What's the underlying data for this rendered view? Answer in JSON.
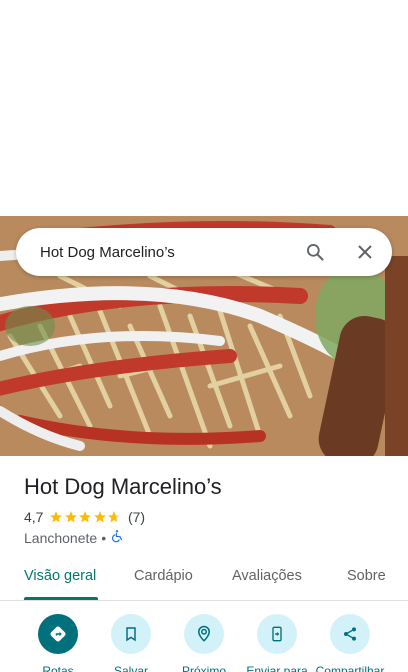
{
  "search": {
    "query": "Hot Dog Marcelino’s"
  },
  "place": {
    "name": "Hot Dog Marcelino’s",
    "rating": "4,7",
    "rating_value": 4.7,
    "review_count": "(7)",
    "category": "Lanchonete",
    "separator": "•",
    "accessibility_icon": "wheelchair-icon"
  },
  "tabs": [
    {
      "label": "Visão geral",
      "active": true
    },
    {
      "label": "Cardápio"
    },
    {
      "label": "Avaliações"
    },
    {
      "label": "Sobre"
    }
  ],
  "actions": [
    {
      "label": "Rotas",
      "icon": "directions-icon"
    },
    {
      "label": "Salvar",
      "icon": "bookmark-icon"
    },
    {
      "label": "Próximo",
      "icon": "nearby-icon"
    },
    {
      "label": "Enviar para",
      "icon": "send-to-phone-icon"
    },
    {
      "label": "Compartilhar",
      "icon": "share-icon"
    }
  ],
  "colors": {
    "accent": "#00796b",
    "star": "#fbbc04",
    "action_bg": "#d3f1f8",
    "primary_action": "#00707c"
  }
}
